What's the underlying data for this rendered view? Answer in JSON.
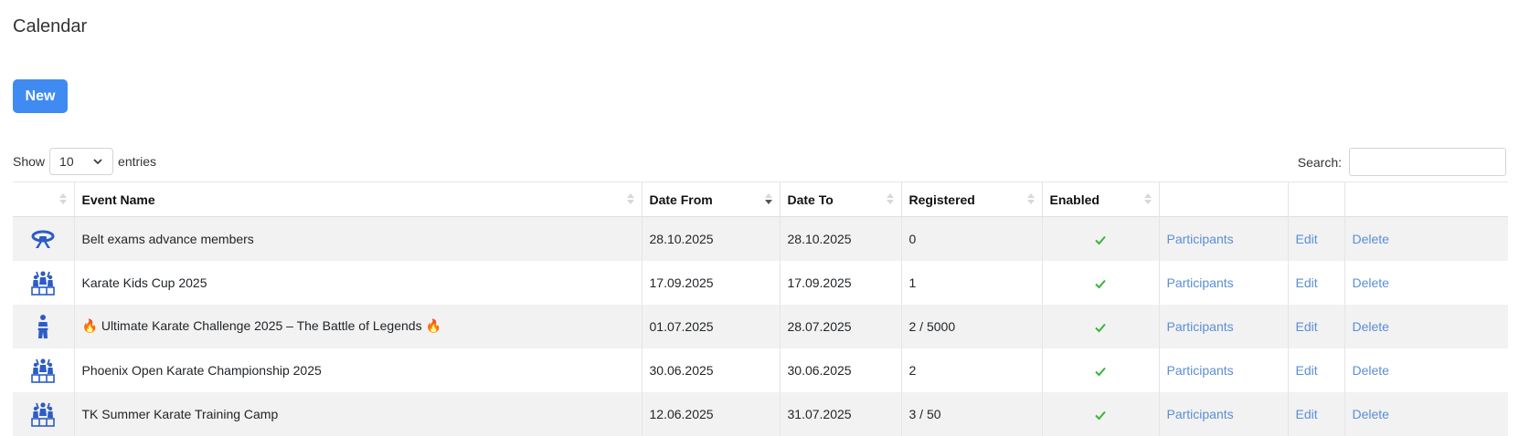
{
  "page": {
    "title": "Calendar",
    "new_button": "New"
  },
  "length": {
    "show_label": "Show",
    "value": "10",
    "entries_label": "entries"
  },
  "search": {
    "label": "Search:",
    "value": ""
  },
  "table": {
    "headers": [
      "",
      "Event Name",
      "Date From",
      "Date To",
      "Registered",
      "Enabled",
      "",
      "",
      ""
    ],
    "sorted_column": "Date From",
    "sort_direction": "descending",
    "rows": [
      {
        "icon": "belt-icon",
        "name": "Belt exams advance members",
        "date_from": "28.10.2025",
        "date_to": "28.10.2025",
        "registered": "0",
        "enabled": true,
        "participants": "Participants",
        "edit": "Edit",
        "delete": "Delete"
      },
      {
        "icon": "podium-group-icon",
        "name": "Karate Kids Cup 2025",
        "date_from": "17.09.2025",
        "date_to": "17.09.2025",
        "registered": "1",
        "enabled": true,
        "participants": "Participants",
        "edit": "Edit",
        "delete": "Delete"
      },
      {
        "icon": "karateka-icon",
        "name_prefix": "🔥",
        "name": "Ultimate Karate Challenge 2025 – The Battle of Legends",
        "name_suffix": "🔥",
        "date_from": "01.07.2025",
        "date_to": "28.07.2025",
        "registered": "2 / 5000",
        "enabled": true,
        "participants": "Participants",
        "edit": "Edit",
        "delete": "Delete"
      },
      {
        "icon": "podium-group-icon",
        "name": "Phoenix Open Karate Championship 2025",
        "date_from": "30.06.2025",
        "date_to": "30.06.2025",
        "registered": "2",
        "enabled": true,
        "participants": "Participants",
        "edit": "Edit",
        "delete": "Delete"
      },
      {
        "icon": "podium-group-icon",
        "name": "TK Summer Karate Training Camp",
        "date_from": "12.06.2025",
        "date_to": "31.07.2025",
        "registered": "3 / 50",
        "enabled": true,
        "participants": "Participants",
        "edit": "Edit",
        "delete": "Delete"
      }
    ]
  },
  "colors": {
    "accent": "#3f8bf1",
    "link": "#5b8ed6",
    "check": "#3bb33b",
    "icon": "#2c5cc5"
  }
}
